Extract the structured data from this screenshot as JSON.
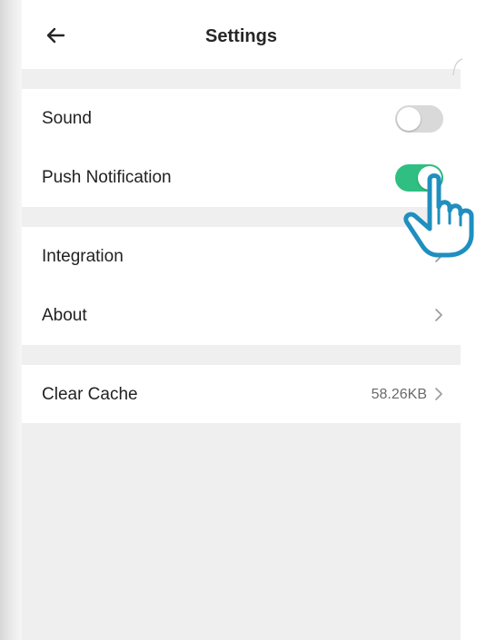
{
  "header": {
    "title": "Settings"
  },
  "settings": {
    "sound": {
      "label": "Sound",
      "enabled": false
    },
    "push": {
      "label": "Push Notification",
      "enabled": true
    },
    "integration": {
      "label": "Integration"
    },
    "about": {
      "label": "About"
    },
    "cache": {
      "label": "Clear Cache",
      "value": "58.26KB"
    }
  },
  "colors": {
    "toggle_on": "#2fbf82",
    "toggle_off": "#d9d9d9",
    "background": "#efefef",
    "cursor_outline": "#1f8fbf"
  },
  "icons": [
    "back-arrow-icon",
    "chevron-right-icon",
    "pointer-hand-icon"
  ]
}
